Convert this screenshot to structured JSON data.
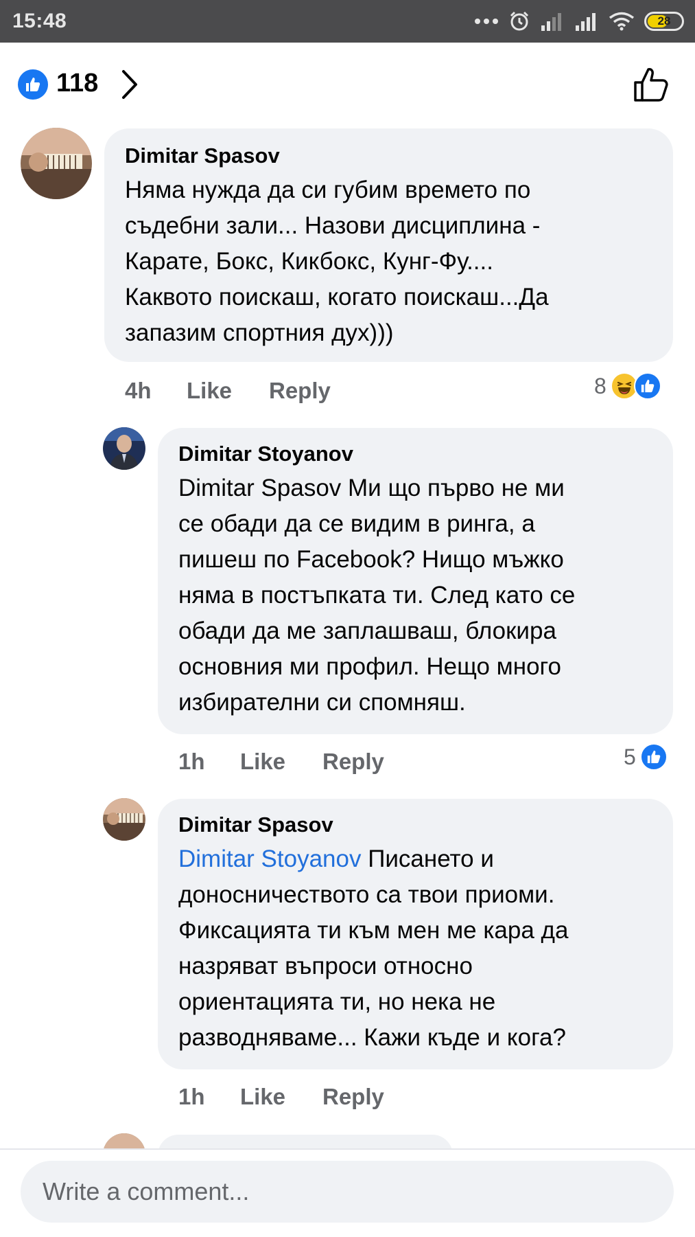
{
  "status_bar": {
    "time": "15:48",
    "battery": "28"
  },
  "reactions": {
    "count": "118"
  },
  "comments": [
    {
      "author": "Dimitar Spasov",
      "lines": [
        "Няма нужда да си губим времето по",
        "съдебни зали... Назови дисциплина -",
        "Карате, Бокс, Кикбокс, Кунг-Фу....",
        "Каквото поискаш, когато поискаш...Да",
        "запазим спортния дух)))"
      ],
      "time": "4h",
      "like_label": "Like",
      "reply_label": "Reply",
      "reaction_count": "8"
    },
    {
      "author": "Dimitar Stoyanov",
      "lines": [
        "Dimitar Spasov Ми що първо не ми",
        "се обади да се видим в ринга, а",
        "пишеш по Facebook? Нищо мъжко",
        "няма в постъпката ти. След като се",
        "обади да ме заплашваш, блокира",
        "основния ми профил.  Нещо много",
        "избирателни си спомняш."
      ],
      "time": "1h",
      "like_label": "Like",
      "reply_label": "Reply",
      "reaction_count": "5"
    },
    {
      "author": "Dimitar Spasov",
      "mention": "Dimitar Stoyanov",
      "first_line_rest": " Писането и",
      "lines": [
        "доносничеството са твои приоми.",
        "Фиксацията ти към мен ме кара да",
        "назряват въпроси относно",
        "ориентацията ти, но нека не",
        "разводняваме... Кажи къде и кога?"
      ],
      "time": "1h",
      "like_label": "Like",
      "reply_label": "Reply"
    }
  ],
  "composer": {
    "placeholder": "Write a comment..."
  },
  "colors": {
    "accent": "#1877f2",
    "bubble": "#f0f2f5",
    "meta": "#65676b",
    "mention": "#216fdb"
  },
  "icons": [
    "like-icon",
    "chevron-right-icon",
    "thumbs-up-outline-icon",
    "haha-icon",
    "wifi-icon",
    "signal-icon",
    "alarm-icon",
    "more-dots-icon"
  ]
}
